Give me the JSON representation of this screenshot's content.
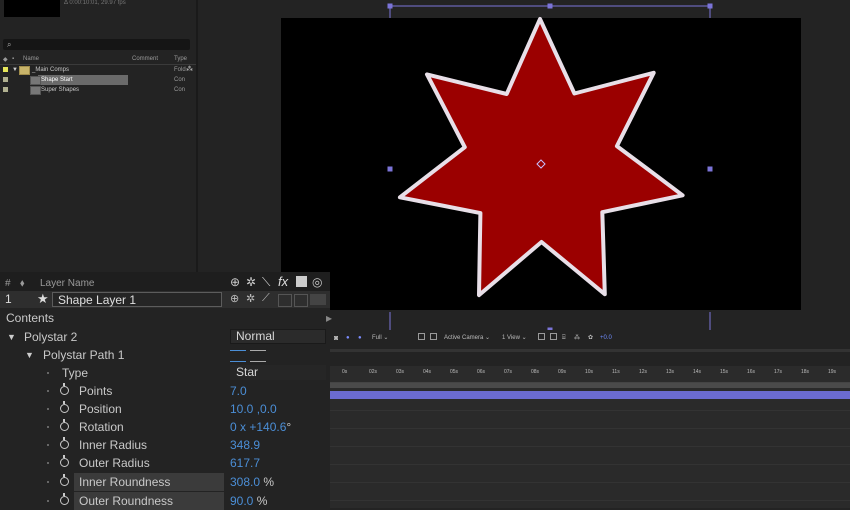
{
  "project": {
    "info_text": "Δ 0:00:10:01, 29.97 fps",
    "search_placeholder": "",
    "columns": {
      "name": "Name",
      "comment": "Comment",
      "type": "Type"
    },
    "items": [
      {
        "name": "_Main Comps",
        "type": "Fold",
        "swatch": "#e6e65a",
        "kind": "folder"
      },
      {
        "name": "Shape Start",
        "type": "Con",
        "swatch": "#b0b090",
        "kind": "comp",
        "selected": true
      },
      {
        "name": "Super Shapes",
        "type": "Con",
        "swatch": "#b0b090",
        "kind": "comp"
      }
    ]
  },
  "viewer": {
    "fill_color": "#9b0000",
    "stroke_color": "#e8dfe8",
    "toolbar": {
      "resolution": "Full",
      "camera": "Active Camera",
      "views": "1 View",
      "exposure": "+0.0"
    }
  },
  "timeline": {
    "columns": {
      "num": "#",
      "layer_name": "Layer Name"
    },
    "layer": {
      "number": "1",
      "name": "Shape Layer 1"
    },
    "contents_label": "Contents",
    "polystar_group": "Polystar 2",
    "blend_mode": "Normal",
    "path_label": "Polystar Path 1",
    "properties": [
      {
        "label": "Type",
        "value": "Star",
        "kind": "dropdown"
      },
      {
        "label": "Points",
        "value": "7.0",
        "unit": ""
      },
      {
        "label": "Position",
        "value": "10.0 ,0.0",
        "unit": ""
      },
      {
        "label": "Rotation",
        "value": "0 x +140.6",
        "unit": "°"
      },
      {
        "label": "Inner Radius",
        "value": "348.9",
        "unit": ""
      },
      {
        "label": "Outer Radius",
        "value": "617.7",
        "unit": ""
      },
      {
        "label": "Inner Roundness",
        "value": "308.0",
        "unit": "%"
      },
      {
        "label": "Outer Roundness",
        "value": "90.0",
        "unit": "%"
      }
    ],
    "ruler_ticks": [
      "0s",
      "02s",
      "03s",
      "04s",
      "05s",
      "06s",
      "07s",
      "08s",
      "09s",
      "10s",
      "11s",
      "12s",
      "13s",
      "14s",
      "15s",
      "16s",
      "17s",
      "18s",
      "19s"
    ]
  }
}
